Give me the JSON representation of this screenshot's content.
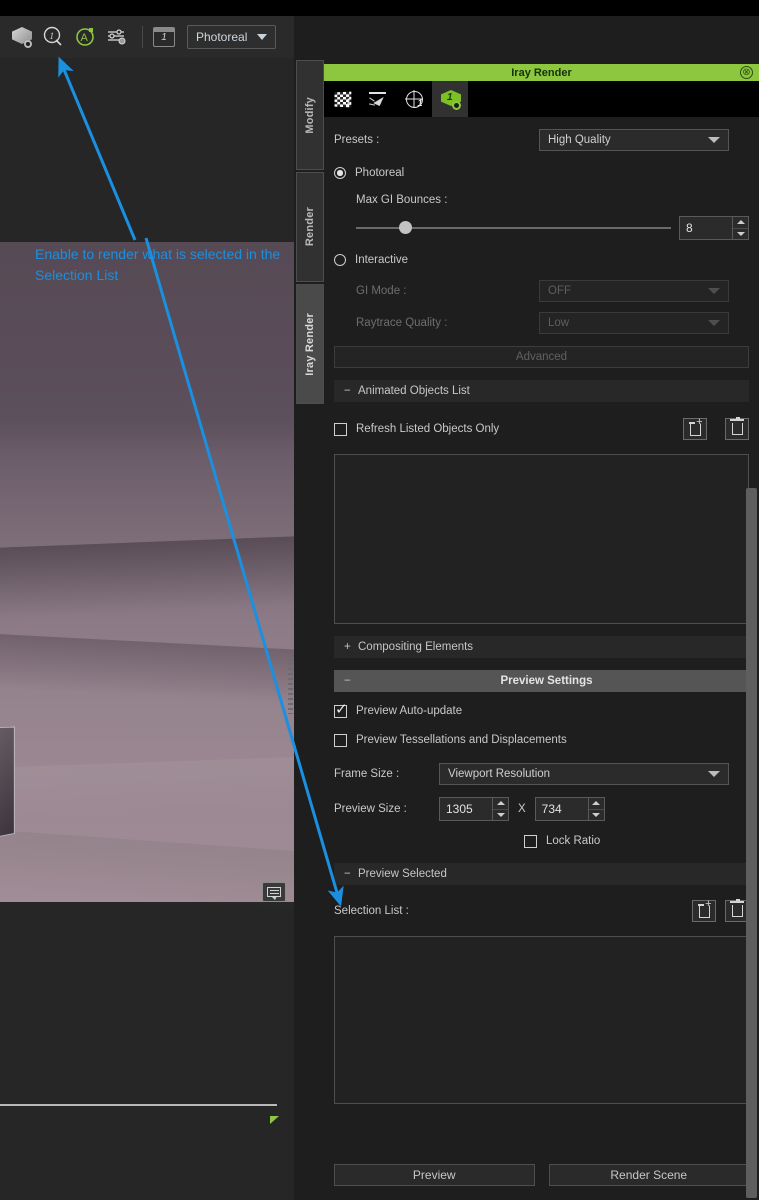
{
  "toolbar": {
    "icons": [
      {
        "name": "render-scene-icon",
        "title": "Render"
      },
      {
        "name": "spot-render-icon",
        "title": "Spot Render"
      },
      {
        "name": "aux-viewport-icon",
        "title": "Auxiliary Viewport"
      },
      {
        "name": "render-settings-icon",
        "title": "Render Settings"
      }
    ],
    "frame_counter": "1",
    "draw_style": "Photoreal"
  },
  "vertical_tabs": [
    {
      "label": "Modify",
      "active": false
    },
    {
      "label": "Render",
      "active": false
    },
    {
      "label": "Iray Render",
      "active": true
    }
  ],
  "panel": {
    "title": "Iray Render",
    "close_label": "⊗",
    "tabs": [
      {
        "name": "checker-tab",
        "active": false
      },
      {
        "name": "spotlight-tab",
        "active": false
      },
      {
        "name": "globe-tab",
        "active": false
      },
      {
        "name": "iray-cube-tab",
        "active": true
      }
    ],
    "presets": {
      "label": "Presets :",
      "value": "High Quality"
    },
    "photoreal": {
      "label": "Photoreal",
      "selected": true,
      "max_gi_bounces_label": "Max GI Bounces :",
      "max_gi_bounces_value": "8",
      "slider_percent": 13.5
    },
    "interactive": {
      "label": "Interactive",
      "selected": false,
      "gi_mode_label": "GI Mode :",
      "gi_mode_value": "OFF",
      "raytrace_quality_label": "Raytrace Quality :",
      "raytrace_quality_value": "Low"
    },
    "advanced_button": "Advanced",
    "animated_objects": {
      "header": "Animated Objects List",
      "sign": "−",
      "refresh_checkbox_label": "Refresh Listed Objects Only",
      "refresh_checked": false,
      "add_icon": "add-item-icon",
      "delete_icon": "delete-item-icon",
      "items": []
    },
    "compositing_elements": {
      "header": "Compositing Elements",
      "sign": "+"
    },
    "preview_settings": {
      "header": "Preview Settings",
      "sign": "−",
      "auto_update_label": "Preview Auto-update",
      "auto_update_checked": true,
      "tessellations_label": "Preview Tessellations and Displacements",
      "tessellations_checked": false,
      "frame_size_label": "Frame Size :",
      "frame_size_value": "Viewport Resolution",
      "preview_size_label": "Preview Size :",
      "preview_width": "1305",
      "preview_separator": "X",
      "preview_height": "734",
      "lock_ratio_label": "Lock Ratio",
      "lock_ratio_checked": false
    },
    "preview_selected": {
      "header": "Preview Selected",
      "sign": "−",
      "selection_list_label": "Selection List :",
      "add_icon": "add-item-icon",
      "delete_icon": "delete-item-icon",
      "items": []
    },
    "buttons": {
      "preview": "Preview",
      "render_scene": "Render Scene"
    }
  },
  "annotation": {
    "text": "Enable to render what is selected in the Selection List",
    "color": "#1b8fe0"
  },
  "colors": {
    "accent_green": "#8dc63f",
    "panel_bg": "#1e1e1e",
    "annotation_blue": "#1b8fe0"
  }
}
